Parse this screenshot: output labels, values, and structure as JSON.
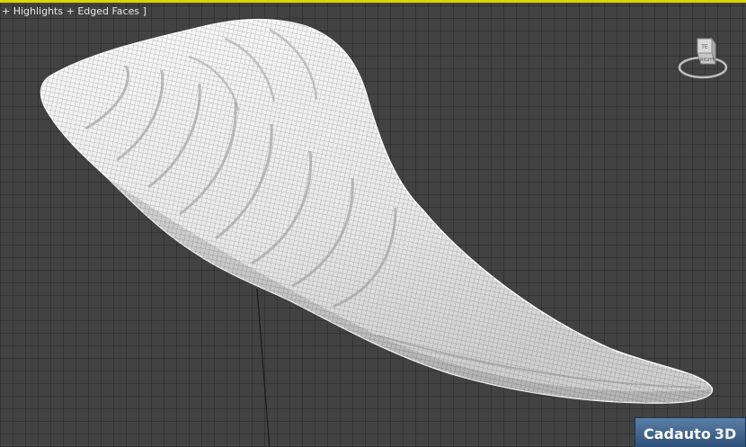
{
  "viewport": {
    "label": "+ Highlights + Edged Faces ]"
  },
  "viewcube": {
    "face_top": "TE",
    "face_right": "RIGHT"
  },
  "watermark": {
    "brand": "Cadauto",
    "suffix": "3D"
  },
  "scene": {
    "object": "wing-mesh",
    "mesh_color": "#f2f2f2",
    "grid_color": "#424242",
    "border_color": "#d8d800"
  }
}
